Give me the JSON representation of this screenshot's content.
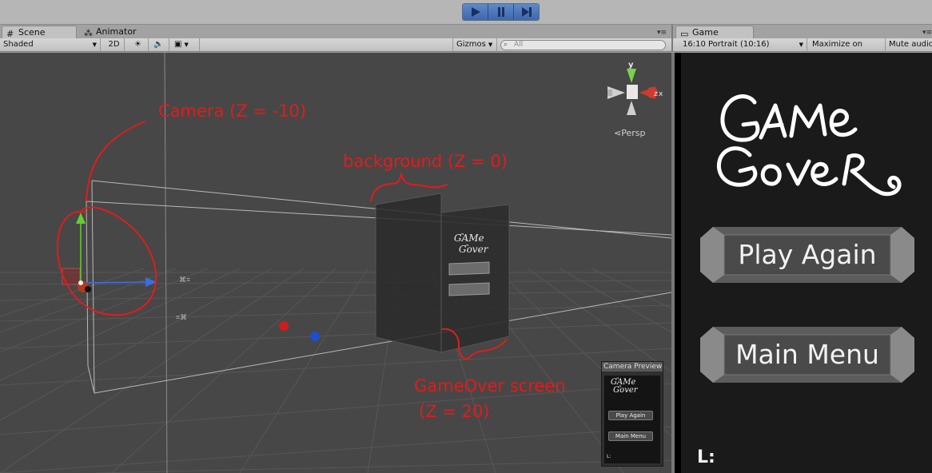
{
  "toolbar": {
    "play_icon": "play-icon",
    "pause_icon": "pause-icon",
    "step_icon": "step-icon"
  },
  "scene": {
    "tabs": [
      {
        "label": "Scene",
        "icon": "grid-icon"
      },
      {
        "label": "Animator",
        "icon": "animator-icon"
      }
    ],
    "shading_mode": "Shaded",
    "mode_2d": "2D",
    "gizmos_label": "Gizmos",
    "search_placeholder": "All",
    "persp_label": "Persp",
    "gizmo_axes": {
      "y": "y",
      "x": "x",
      "z": "z"
    },
    "annotations": {
      "camera": "Camera (Z = -10)",
      "background": "background (Z = 0)",
      "gameover_line1": "GameOver screen",
      "gameover_line2": "(Z = 20)"
    },
    "camera_preview": {
      "title": "Camera Preview",
      "play_again": "Play Again",
      "main_menu": "Main Menu",
      "l_label": "L:"
    }
  },
  "game": {
    "tab_label": "Game",
    "aspect": "16:10 Portrait (10:16)",
    "maximize_label": "Maximize on Play",
    "mute_label": "Mute audio",
    "title_line1": "GAME",
    "title_line2": "OVER",
    "play_again_label": "Play Again",
    "main_menu_label": "Main Menu",
    "l_label": "L:"
  },
  "colors": {
    "annotation": "#e11c1c",
    "play_button": "#4a78bd",
    "scene_bg": "#454545",
    "game_bg": "#1a1a1a"
  }
}
